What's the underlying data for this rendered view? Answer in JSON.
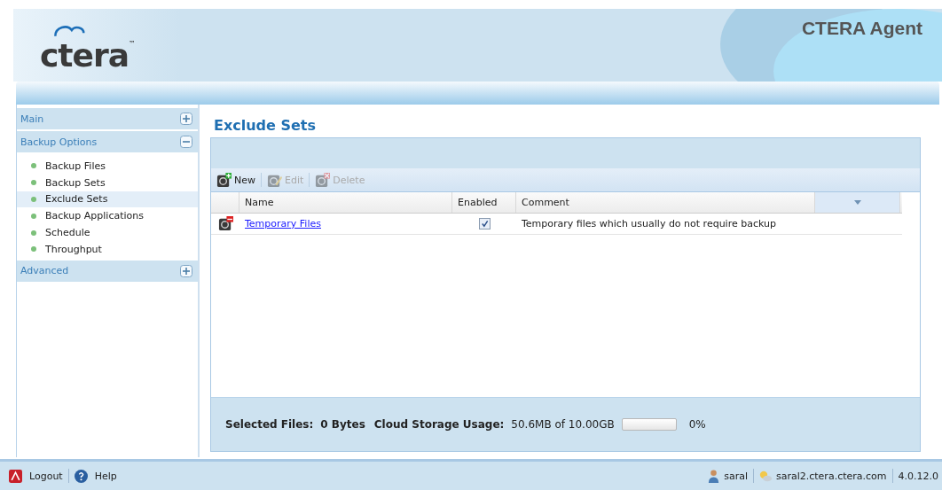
{
  "header": {
    "logo": "ctera",
    "trademark": "™",
    "product": "CTERA Agent"
  },
  "sidebar": [
    {
      "label": "Main",
      "expanded": false
    },
    {
      "label": "Backup Options",
      "expanded": true,
      "children": [
        {
          "label": "Backup Files",
          "selected": false
        },
        {
          "label": "Backup Sets",
          "selected": false
        },
        {
          "label": "Exclude Sets",
          "selected": true
        },
        {
          "label": "Backup Applications",
          "selected": false
        },
        {
          "label": "Schedule",
          "selected": false
        },
        {
          "label": "Throughput",
          "selected": false
        }
      ]
    },
    {
      "label": "Advanced",
      "expanded": false
    }
  ],
  "content": {
    "title": "Exclude Sets",
    "toolbar": [
      {
        "kind": "new",
        "label": "New",
        "disabled": false
      },
      {
        "kind": "edit",
        "label": "Edit",
        "disabled": true
      },
      {
        "kind": "delete",
        "label": "Delete",
        "disabled": true
      }
    ],
    "table": {
      "columns": [
        "Name",
        "Enabled",
        "Comment"
      ],
      "rows": [
        {
          "name": "Temporary Files",
          "enabled": true,
          "comment": "Temporary files which usually do not require backup"
        }
      ]
    },
    "summary": {
      "selected_label": "Selected Files:",
      "selected_value": "0 Bytes",
      "usage_label": "Cloud Storage Usage:",
      "usage_value": "50.6MB of 10.00GB",
      "level": 0,
      "percent": "0%"
    }
  },
  "status_bar": {
    "logout": "Logout",
    "help": "Help",
    "user": "saral",
    "server": "saral2.ctera.ctera.com",
    "version": "4.0.12.0"
  }
}
